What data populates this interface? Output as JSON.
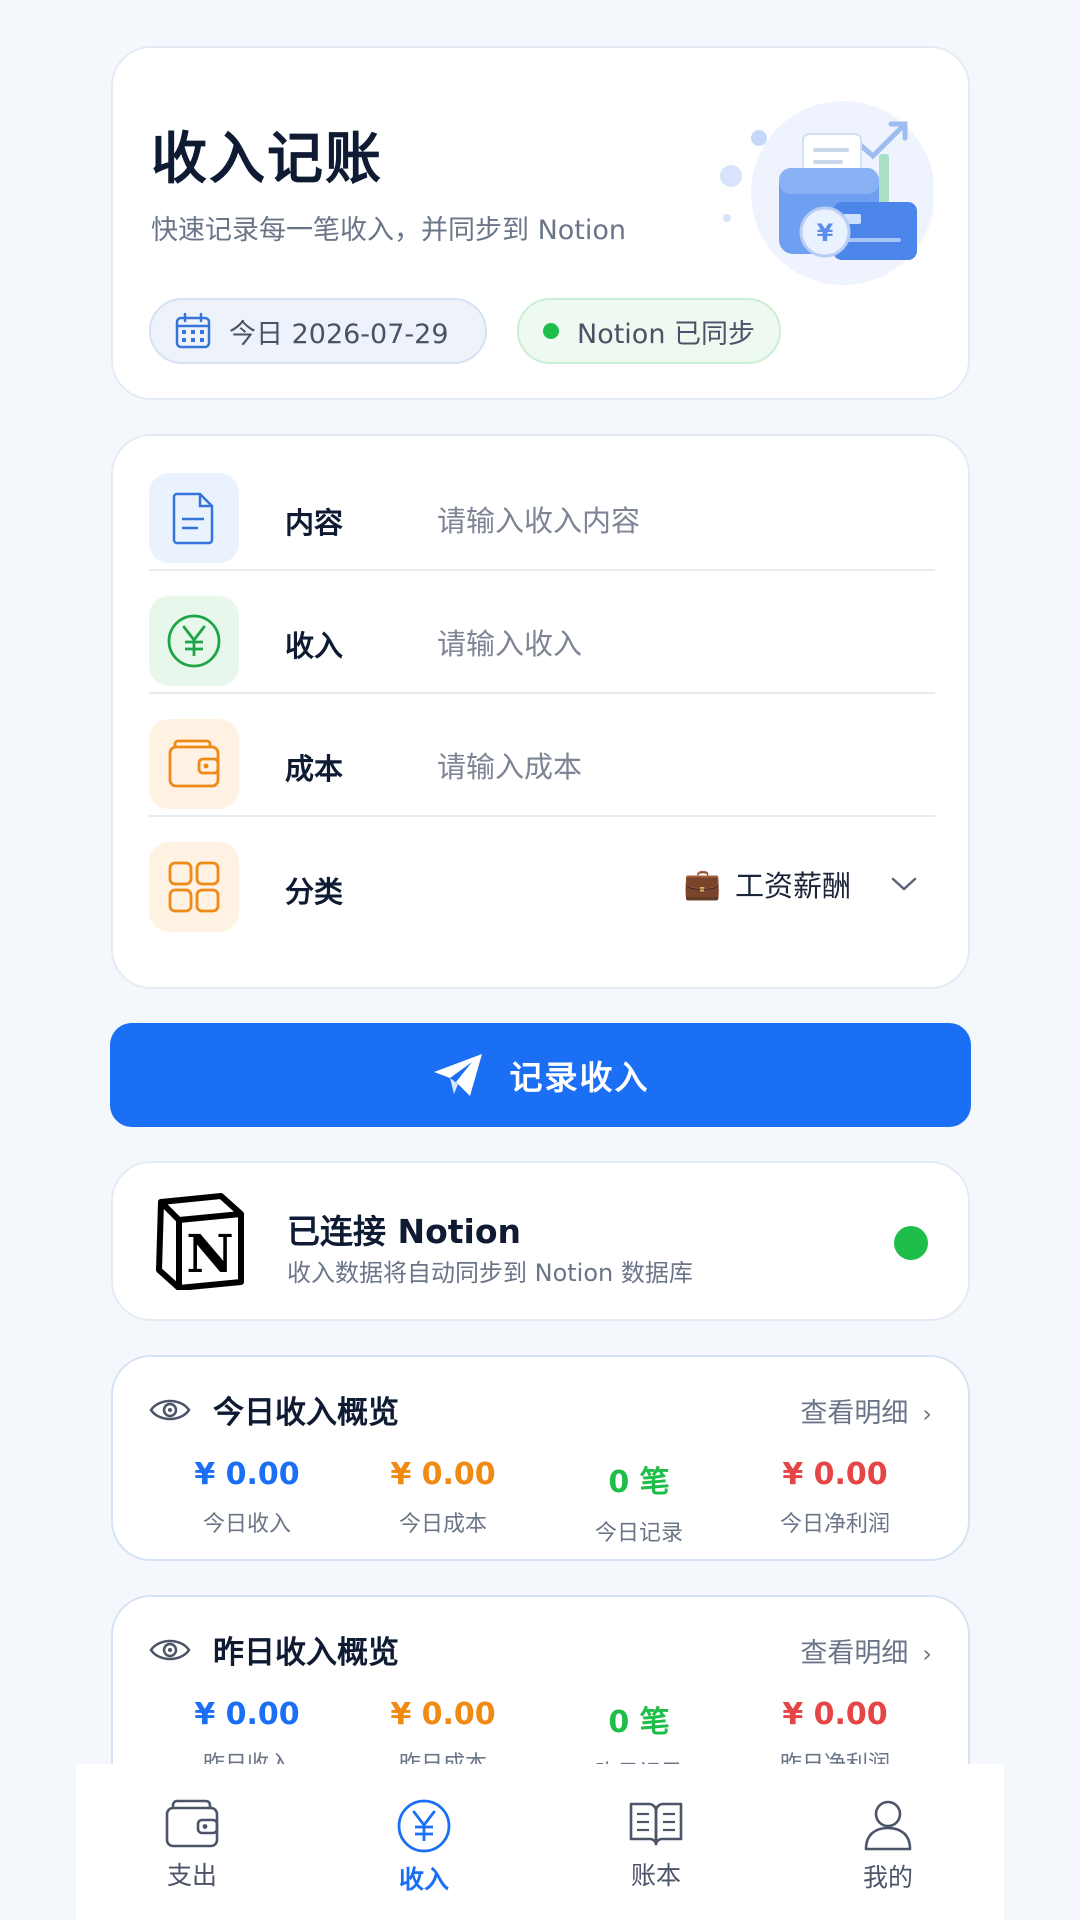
{
  "header": {
    "title": "收入记账",
    "subtitle": "快速记录每一笔收入，并同步到 Notion",
    "date_label": "今日 2026-07-29",
    "sync_label": "Notion 已同步"
  },
  "form": {
    "content": {
      "label": "内容",
      "placeholder": "请输入收入内容"
    },
    "income": {
      "label": "收入",
      "placeholder": "请输入收入"
    },
    "cost": {
      "label": "成本",
      "placeholder": "请输入成本"
    },
    "category": {
      "label": "分类",
      "emoji": "💼",
      "value": "工资薪酬"
    }
  },
  "record_button": {
    "label": "记录收入"
  },
  "notion": {
    "logo_letter": "N",
    "title": "已连接 Notion",
    "subtitle": "收入数据将自动同步到 Notion 数据库"
  },
  "today": {
    "title": "今日收入概览",
    "link": "查看明细",
    "stats": [
      {
        "value": "¥ 0.00",
        "caption": "今日收入",
        "color": "#1a6ff5"
      },
      {
        "value": "¥ 0.00",
        "caption": "今日成本",
        "color": "#f08a12"
      },
      {
        "value": "0 笔",
        "caption": "今日记录",
        "color": "#1fbe4a"
      },
      {
        "value": "¥ 0.00",
        "caption": "今日净利润",
        "color": "#e64545"
      }
    ]
  },
  "yesterday": {
    "title": "昨日收入概览",
    "link": "查看明细",
    "stats": [
      {
        "value": "¥ 0.00",
        "caption": "昨日收入",
        "color": "#1a6ff5"
      },
      {
        "value": "¥ 0.00",
        "caption": "昨日成本",
        "color": "#f08a12"
      },
      {
        "value": "0 笔",
        "caption": "昨日记录",
        "color": "#1fbe4a"
      },
      {
        "value": "¥ 0.00",
        "caption": "昨日净利润",
        "color": "#e64545"
      }
    ]
  },
  "tabs": [
    {
      "label": "支出",
      "icon": "wallet-icon"
    },
    {
      "label": "收入",
      "icon": "yen-circle-icon",
      "active": true
    },
    {
      "label": "账本",
      "icon": "book-icon"
    },
    {
      "label": "我的",
      "icon": "user-icon"
    }
  ],
  "colors": {
    "accent": "#1a6ff5",
    "success": "#1fbe4a",
    "warning": "#f08a12",
    "danger": "#e64545"
  }
}
